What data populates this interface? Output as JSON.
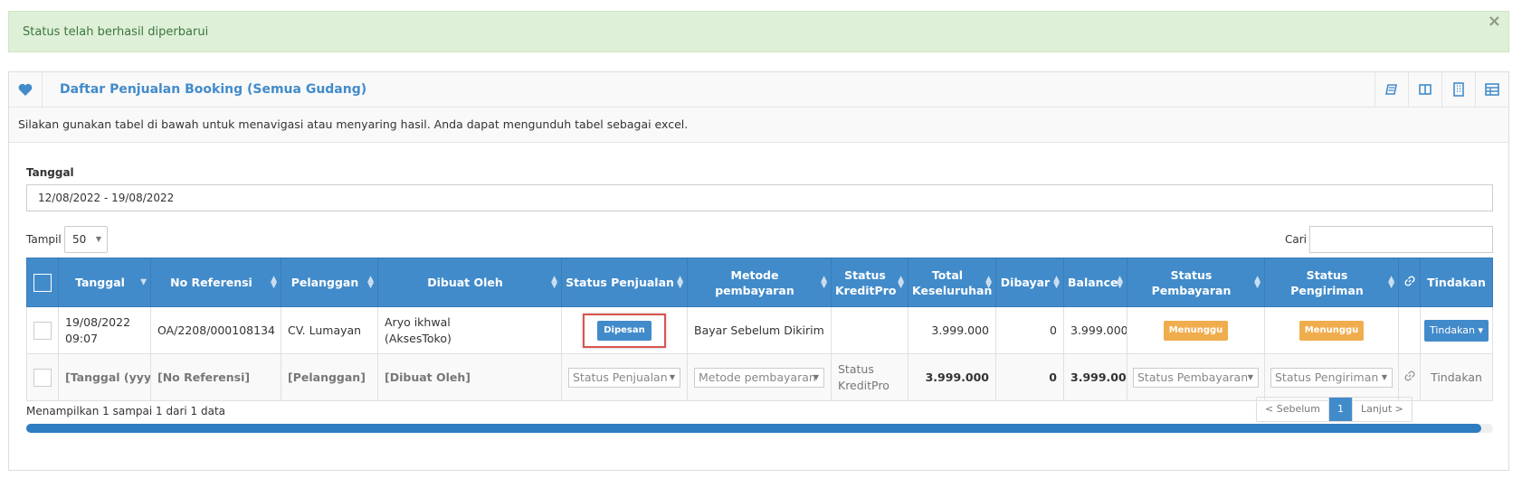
{
  "alert": {
    "message": "Status telah berhasil diperbarui",
    "close": "×"
  },
  "box": {
    "title": "Daftar Penjualan Booking (Semua Gudang)",
    "intro": "Silakan gunakan tabel di bawah untuk menavigasi atau menyaring hasil. Anda dapat mengunduh tabel sebagai excel."
  },
  "filters": {
    "date_label": "Tanggal",
    "date_value": "12/08/2022 - 19/08/2022",
    "show_label": "Tampil",
    "show_value": "50",
    "search_label": "Cari"
  },
  "table": {
    "headers": [
      "Tanggal",
      "No Referensi",
      "Pelanggan",
      "Dibuat Oleh",
      "Status Penjualan",
      "Metode pembayaran",
      "Status KreditPro",
      "Total Keseluruhan",
      "Dibayar",
      "Balance",
      "Status Pembayaran",
      "Status Pengiriman",
      "Tindakan"
    ],
    "row": {
      "date": "19/08/2022",
      "time": "09:07",
      "reference": "OA/2208/000108134",
      "customer": "CV. Lumayan",
      "created_by_1": "Aryo ikhwal",
      "created_by_2": "(AksesToko)",
      "sale_status": "Dipesan",
      "payment_method": "Bayar Sebelum Dikirim",
      "kreditpro_status": "",
      "grand_total": "3.999.000",
      "paid": "0",
      "balance": "3.999.000",
      "payment_status": "Menunggu",
      "delivery_status": "Menunggu",
      "action": "Tindakan"
    },
    "filter_row": {
      "date": "[Tanggal (yyyy-mm-dd)]",
      "reference": "[No Referensi]",
      "customer": "[Pelanggan]",
      "created_by": "[Dibuat Oleh]",
      "sale_status": "Status Penjualan",
      "payment_method": "Metode pembayaran",
      "kreditpro_1": "Status",
      "kreditpro_2": "KreditPro",
      "grand_total": "3.999.000",
      "paid": "0",
      "balance": "3.999.000",
      "payment_status": "Status Pembayaran",
      "delivery_status": "Status Pengiriman",
      "action": "Tindakan"
    }
  },
  "footer": {
    "info": "Menampilkan 1 sampai 1 dari 1 data",
    "prev": "< Sebelum",
    "page": "1",
    "next": "Lanjut >"
  },
  "colors": {
    "primary": "#428bca",
    "warning": "#f0ad4e",
    "success_bg": "#dff0d8",
    "highlight": "#d9534f"
  }
}
